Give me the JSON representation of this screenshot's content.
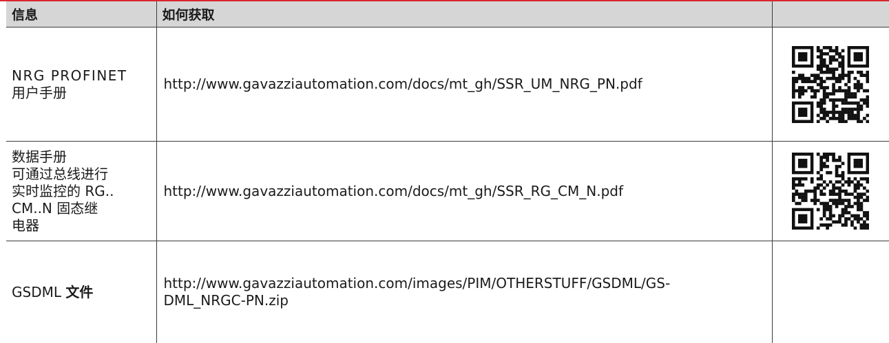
{
  "table": {
    "headers": [
      "信息",
      "如何获取",
      ""
    ],
    "rows": [
      {
        "name_line1": "NRG PROFINET",
        "name_line2": "用户手册",
        "url": "http://www.gavazziautomation.com/docs/mt_gh/SSR_UM_NRG_PN.pdf",
        "has_qr": true
      },
      {
        "name_line1": "数据手册",
        "name_line2": "可通过总线进行",
        "name_line3": "实时监控的 RG..",
        "name_line4": "CM..N 固态继",
        "name_line5": "电器",
        "url": "http://www.gavazziautomation.com/docs/mt_gh/SSR_RG_CM_N.pdf",
        "has_qr": true
      },
      {
        "name_prefix": "GSDML ",
        "name_bold": "文件",
        "url_line1": "http://www.gavazziautomation.com/images/PIM/OTHERSTUFF/GSDML/GS-",
        "url_line2": "DML_NRGC-PN.zip",
        "has_qr": false
      }
    ]
  },
  "colors": {
    "accent": "#d9262c",
    "header_bg": "#d6d6d6",
    "border": "#3a3a3a"
  },
  "icons": [
    "qr-code-icon",
    "qr-code-icon"
  ]
}
